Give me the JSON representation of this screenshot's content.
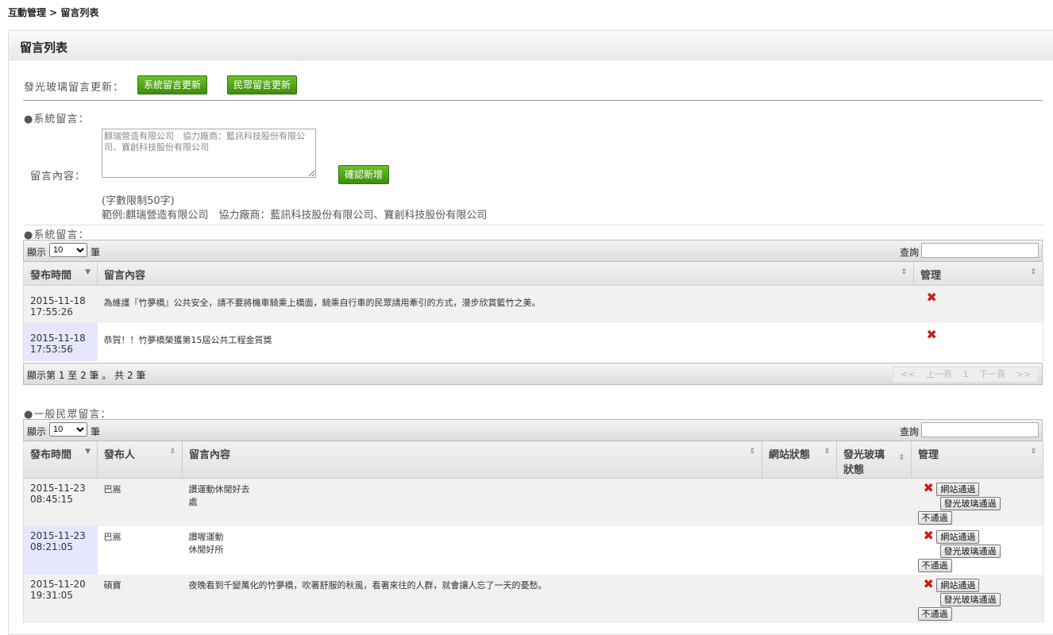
{
  "breadcrumb": "互動管理 > 留言列表",
  "panel_title": "留言列表",
  "update": {
    "label": "發光玻璃留言更新：",
    "system_btn": "系統留言更新",
    "public_btn": "民眾留言更新"
  },
  "system_form": {
    "section_label": "●系統留言：",
    "content_label": "留言內容：",
    "textarea_value": "麒瑞營造有限公司　協力廠商：藍訊科技股份有限公司、寶創科技股份有限公司",
    "confirm_btn": "確認新增",
    "limit_hint": "(字數限制50字)",
    "example_hint": "範例:麒瑞營造有限公司　協力廠商：藍訊科技股份有限公司、寶創科技股份有限公司"
  },
  "system_table": {
    "section_label": "●系統留言：",
    "show_label": "顯示",
    "page_size": "10",
    "unit_label": "筆",
    "search_label": "查詢",
    "headers": [
      "發布時間",
      "留言內容",
      "管理"
    ],
    "rows": [
      {
        "date": "2015-11-18",
        "time": "17:55:26",
        "content": "為維護『竹夢橋』公共安全，請不要將機車騎乘上橋面，騎乘自行車的民眾請用牽引的方式，漫步欣賞籃竹之美。"
      },
      {
        "date": "2015-11-18",
        "time": "17:53:56",
        "content": "恭賀！！竹夢橋榮獲第15屆公共工程金質獎"
      }
    ],
    "footer_info": "顯示第 1 至 2 筆 。 共 2 筆",
    "pager": {
      "first": "<<",
      "prev": "上一頁",
      "page": "1",
      "next": "下一頁",
      "last": ">>"
    }
  },
  "public_table": {
    "section_label": "●一般民眾留言：",
    "show_label": "顯示",
    "page_size": "10",
    "unit_label": "筆",
    "search_label": "查詢",
    "headers": [
      "發布時間",
      "發布人",
      "留言內容",
      "網站狀態",
      "發光玻璃狀態",
      "管理"
    ],
    "rows": [
      {
        "date": "2015-11-23",
        "time": "08:45:15",
        "author": "巴嵩",
        "content1": "讚運動休閒好去",
        "content2": "處"
      },
      {
        "date": "2015-11-23",
        "time": "08:21:05",
        "author": "巴嵩",
        "content1": "讚喔運動",
        "content2": "休閒好所"
      },
      {
        "date": "2015-11-20",
        "time": "19:31:05",
        "author": "碩寶",
        "content1": "夜晚看到千變萬化的竹夢橋，吹著舒服的秋風，看著來往的人群，就會讓人忘了一天的憂愁。",
        "content2": ""
      }
    ],
    "actions": {
      "web_pass": "網站通過",
      "glass_pass": "發光玻璃通過",
      "reject": "不通過"
    }
  },
  "icons": {
    "delete": "delete-x-icon",
    "sort": "sort-arrows-icon"
  },
  "colors": {
    "green_button": "#4a9c17",
    "date_cell": "#cfd0ff",
    "delete": "#c81b1b"
  }
}
